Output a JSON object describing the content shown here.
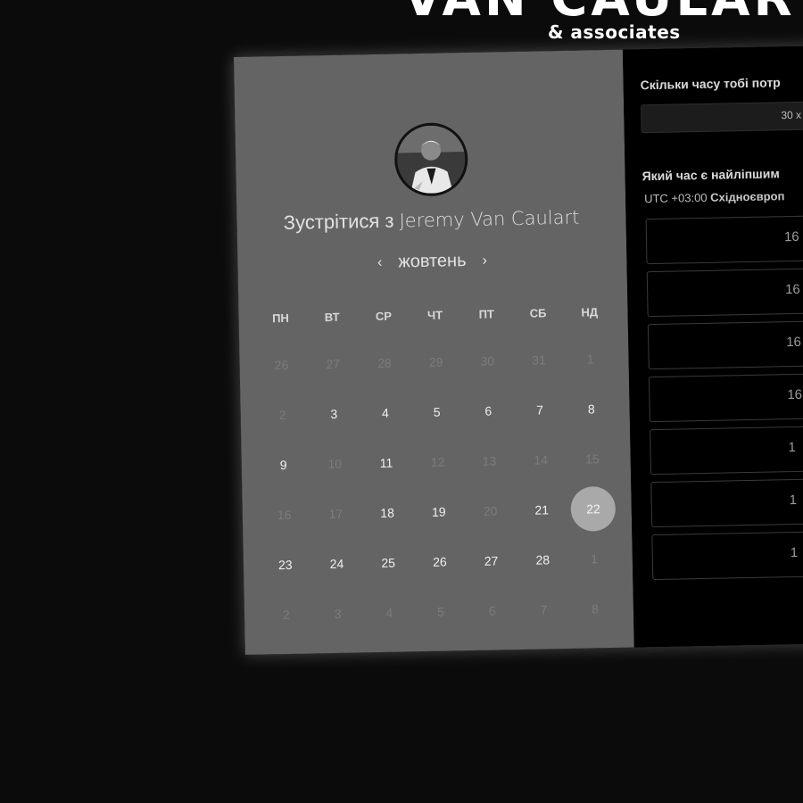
{
  "brand": {
    "title": "VAN CAULART",
    "subtitle": "& associates"
  },
  "calendar": {
    "meet_prefix": "Зустрітися з",
    "host_name": "Jeremy Van Caulart",
    "month": "жовтень",
    "prev_icon": "chevron-left-icon",
    "next_icon": "chevron-right-icon",
    "weekdays": [
      "ПН",
      "ВТ",
      "СР",
      "ЧТ",
      "ПТ",
      "СБ",
      "НД"
    ],
    "weeks": [
      [
        {
          "d": "26",
          "muted": true
        },
        {
          "d": "27",
          "muted": true
        },
        {
          "d": "28",
          "muted": true
        },
        {
          "d": "29",
          "muted": true
        },
        {
          "d": "30",
          "muted": true
        },
        {
          "d": "31",
          "muted": true
        },
        {
          "d": "1",
          "muted": true
        }
      ],
      [
        {
          "d": "2",
          "muted": true
        },
        {
          "d": "3"
        },
        {
          "d": "4"
        },
        {
          "d": "5"
        },
        {
          "d": "6"
        },
        {
          "d": "7"
        },
        {
          "d": "8"
        }
      ],
      [
        {
          "d": "9"
        },
        {
          "d": "10",
          "muted": true
        },
        {
          "d": "11"
        },
        {
          "d": "12",
          "muted": true
        },
        {
          "d": "13",
          "muted": true
        },
        {
          "d": "14",
          "muted": true
        },
        {
          "d": "15",
          "muted": true
        }
      ],
      [
        {
          "d": "16",
          "muted": true
        },
        {
          "d": "17",
          "muted": true
        },
        {
          "d": "18"
        },
        {
          "d": "19"
        },
        {
          "d": "20",
          "muted": true
        },
        {
          "d": "21"
        },
        {
          "d": "22",
          "selected": true
        }
      ],
      [
        {
          "d": "23"
        },
        {
          "d": "24"
        },
        {
          "d": "25"
        },
        {
          "d": "26"
        },
        {
          "d": "27"
        },
        {
          "d": "28"
        },
        {
          "d": "1",
          "muted": true
        }
      ],
      [
        {
          "d": "2",
          "muted": true
        },
        {
          "d": "3",
          "muted": true
        },
        {
          "d": "4",
          "muted": true
        },
        {
          "d": "5",
          "muted": true
        },
        {
          "d": "6",
          "muted": true
        },
        {
          "d": "7",
          "muted": true
        },
        {
          "d": "8",
          "muted": true
        }
      ]
    ]
  },
  "booking": {
    "duration_question": "Скільки часу тобі потр",
    "duration_value": "30 х",
    "time_question": "Який час є найліпшим",
    "tz_offset": "UTC +03:00",
    "tz_name": "Східноєвроп",
    "slots": [
      "16",
      "16",
      "16",
      "16",
      "1",
      "1",
      "1"
    ]
  },
  "colors": {
    "page_bg": "#0b0b0b",
    "calendar_panel": "#646464",
    "time_panel": "#000000",
    "selected_day": "#a9a9a9"
  }
}
